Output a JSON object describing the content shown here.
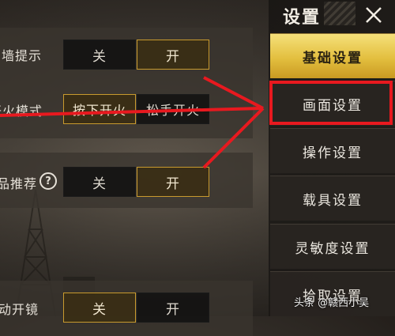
{
  "sidebar": {
    "title": "设置",
    "items": [
      {
        "label": "基础设置",
        "active": true
      },
      {
        "label": "画面设置",
        "active": false
      },
      {
        "label": "操作设置",
        "active": false
      },
      {
        "label": "载具设置",
        "active": false
      },
      {
        "label": "灵敏度设置",
        "active": false
      },
      {
        "label": "拾取设置",
        "active": false
      }
    ]
  },
  "settings": [
    {
      "label": "墙提示",
      "options": [
        "关",
        "开"
      ],
      "selected": "开"
    },
    {
      "label": "开火模式",
      "options": [
        "按下开火",
        "松手开火"
      ],
      "selected": "按下开火"
    },
    {
      "label": "品推荐",
      "options": [
        "关",
        "开"
      ],
      "selected": "开",
      "help": "?"
    },
    {
      "label": "动开镜",
      "options": [
        "关",
        "开"
      ],
      "selected": "关"
    }
  ],
  "watermark": {
    "text": "头条 @赣西小吴"
  },
  "colors": {
    "accent_gold": "#c89a2e",
    "annotation_red": "#e8191f"
  }
}
